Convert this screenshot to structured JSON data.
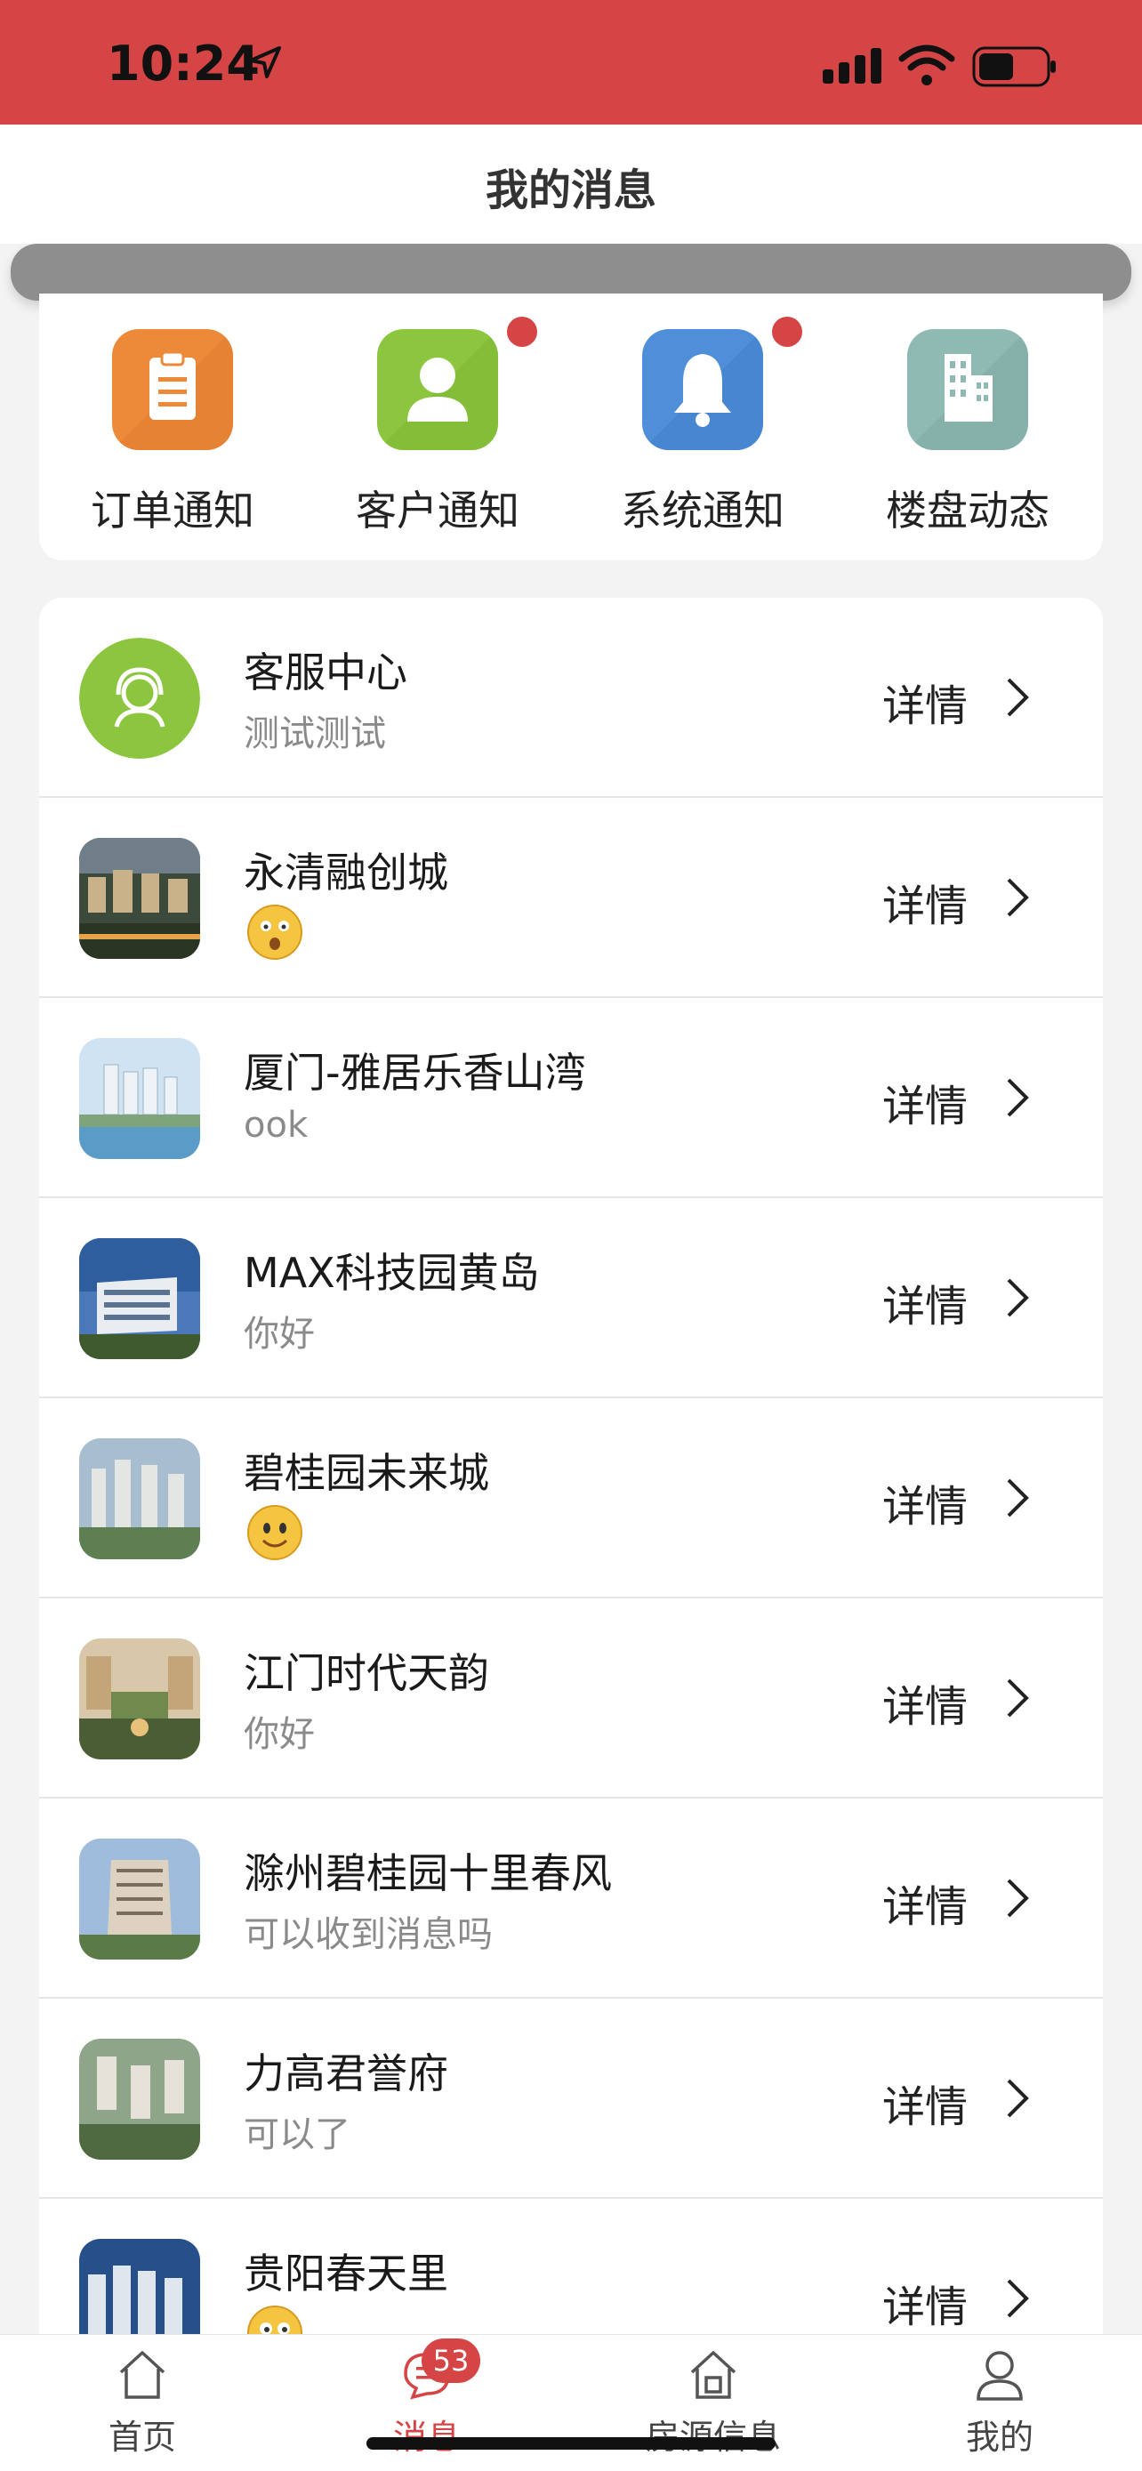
{
  "status_bar": {
    "time": "10:24",
    "icons": [
      "location-arrow-icon",
      "cellular-signal-icon",
      "wifi-icon",
      "battery-icon"
    ]
  },
  "header": {
    "title": "我的消息"
  },
  "categories": [
    {
      "label": "订单通知",
      "icon": "clipboard-icon",
      "color": "#ec8a3a",
      "has_dot": false
    },
    {
      "label": "客户通知",
      "icon": "person-icon",
      "color": "#8cc63f",
      "has_dot": true
    },
    {
      "label": "系统通知",
      "icon": "bell-icon",
      "color": "#4f8ed8",
      "has_dot": true
    },
    {
      "label": "楼盘动态",
      "icon": "building-icon",
      "color": "#8fb9b3",
      "has_dot": false
    }
  ],
  "messages": [
    {
      "name": "客服中心",
      "preview": "测试测试",
      "preview_type": "text",
      "thumb": "customer-service-icon"
    },
    {
      "name": "永清融创城",
      "preview": "",
      "preview_type": "emoji-surprised",
      "thumb": "property-photo"
    },
    {
      "name": "厦门-雅居乐香山湾",
      "preview": "ook",
      "preview_type": "text",
      "thumb": "property-photo"
    },
    {
      "name": "MAX科技园黄岛",
      "preview": "你好",
      "preview_type": "text",
      "thumb": "property-photo"
    },
    {
      "name": "碧桂园未来城",
      "preview": "",
      "preview_type": "emoji-smile",
      "thumb": "property-photo"
    },
    {
      "name": "江门时代天韵",
      "preview": "你好",
      "preview_type": "text",
      "thumb": "property-photo"
    },
    {
      "name": "滁州碧桂园十里春风",
      "preview": "可以收到消息吗",
      "preview_type": "text",
      "thumb": "property-photo"
    },
    {
      "name": "力高君誉府",
      "preview": "可以了",
      "preview_type": "text",
      "thumb": "property-photo"
    },
    {
      "name": "贵阳春天里",
      "preview": "",
      "preview_type": "emoji-eyes",
      "thumb": "property-photo"
    }
  ],
  "detail_label": "详情",
  "tabs": [
    {
      "label": "首页",
      "icon": "home-icon",
      "active": false
    },
    {
      "label": "消息",
      "icon": "message-icon",
      "active": true,
      "badge": "53"
    },
    {
      "label": "房源信息",
      "icon": "house-icon",
      "active": false
    },
    {
      "label": "我的",
      "icon": "user-icon",
      "active": false
    }
  ],
  "colors": {
    "accent": "#d64545",
    "status_bar": "#d64545"
  }
}
